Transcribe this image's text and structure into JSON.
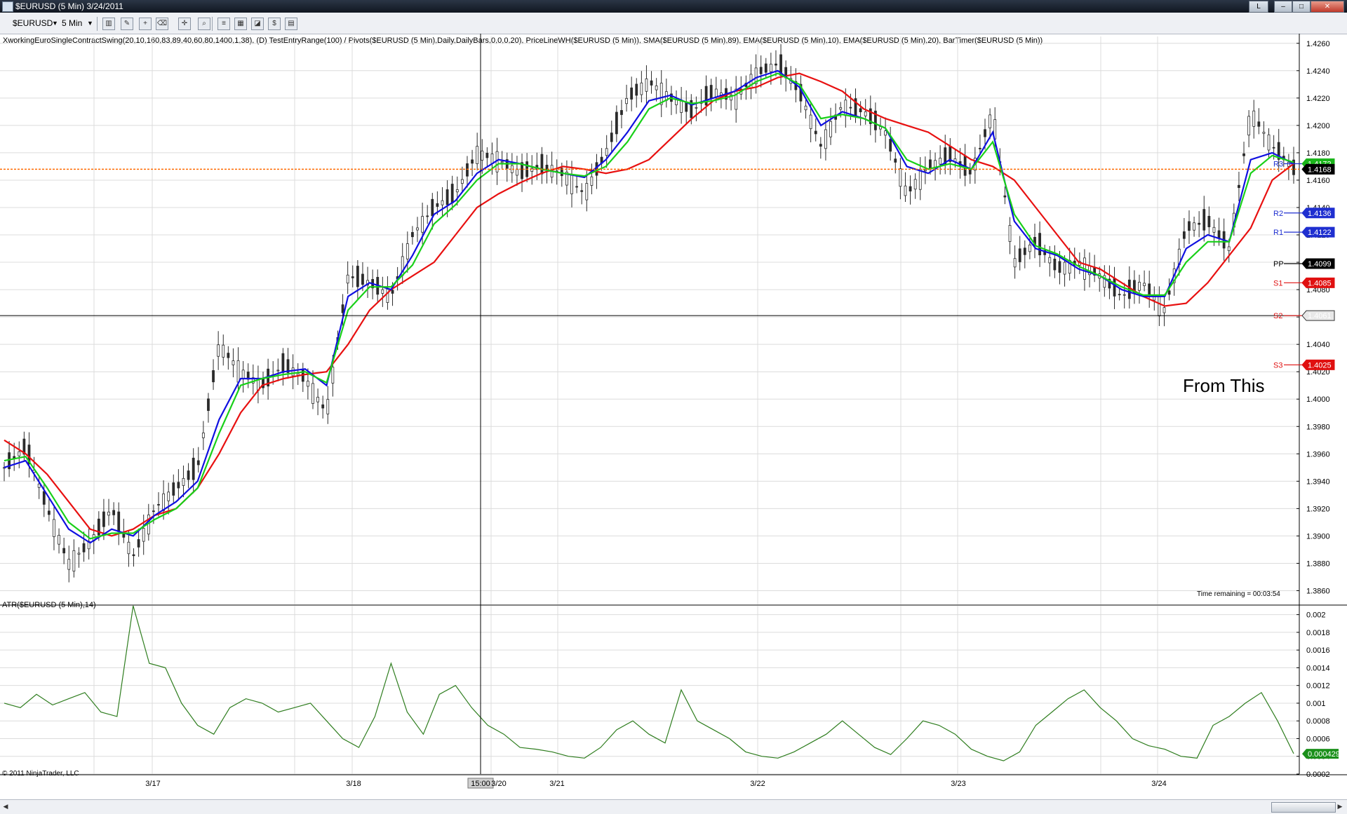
{
  "window": {
    "title": "$EURUSD (5 Min)  3/24/2011",
    "buttons": [
      "L",
      "–",
      "□",
      "✕"
    ]
  },
  "toolbar": {
    "instrument": "$EURUSD",
    "interval": "5 Min",
    "icons": [
      "bars-style-icon",
      "draw-icon",
      "zoom-icon",
      "eraser-icon",
      "crosshair-icon",
      "search-icon",
      "properties-icon",
      "strategies-icon",
      "indicators-icon",
      "data-box-icon",
      "dollar-icon",
      "window-icon"
    ]
  },
  "indicator_text": "XworkingEuroSingleContractSwing(20,10,160,83,89,40,60,80,1400,1,38), (D) TestEntryRange(100) / Pivots($EURUSD (5 Min),Daily,DailyBars,0,0,0,20), PriceLineWH($EURUSD (5 Min)), SMA($EURUSD (5 Min),89), EMA($EURUSD (5 Min),10), EMA($EURUSD (5 Min),20), BarTimer($EURUSD (5 Min))",
  "atr_label": "ATR($EURUSD (5 Min),14)",
  "time_remaining": "Time remaining = 00:03:54",
  "copyright": "© 2011 NinjaTrader, LLC",
  "annotation": "From This",
  "crosshair_time": "15:00",
  "colors": {
    "sma": "#e81010",
    "ema_fast": "#1010e0",
    "ema_slow": "#18d018",
    "candle": "#2b2b2b",
    "atr": "#2e7d1e",
    "price_line": "#ff6a00",
    "pivot_r": "#1f2fd0",
    "pivot_s": "#e01010",
    "pivot_pp": "#000000"
  },
  "chart_data": [
    {
      "type": "line",
      "title": "$EURUSD (5 Min)",
      "x": [
        "3/17",
        "3/18",
        "3/20",
        "3/21",
        "3/22",
        "3/23",
        "3/24"
      ],
      "ylim": [
        1.385,
        1.4265
      ],
      "yticks": [
        "1.4260",
        "1.4240",
        "1.4220",
        "1.4200",
        "1.4180",
        "1.4160",
        "1.4140",
        "1.4120",
        "1.4100",
        "1.4080",
        "1.4060",
        "1.4040",
        "1.4020",
        "1.4000",
        "1.3980",
        "1.3960",
        "1.3940",
        "1.3920",
        "1.3900",
        "1.3880",
        "1.3860"
      ],
      "grid": true,
      "series": [
        {
          "name": "SMA($EURUSD (5 Min),89)",
          "values": [
            1.397,
            1.396,
            1.3945,
            1.3925,
            1.3905,
            1.39,
            1.3905,
            1.3915,
            1.392,
            1.3935,
            1.396,
            1.399,
            1.401,
            1.4015,
            1.4018,
            1.402,
            1.404,
            1.4065,
            1.408,
            1.409,
            1.41,
            1.412,
            1.414,
            1.415,
            1.4158,
            1.4165,
            1.417,
            1.4168,
            1.4165,
            1.4168,
            1.4175,
            1.419,
            1.4205,
            1.4218,
            1.4225,
            1.4228,
            1.4235,
            1.4238,
            1.4232,
            1.4225,
            1.4212,
            1.4205,
            1.42,
            1.4195,
            1.4185,
            1.4175,
            1.417,
            1.416,
            1.414,
            1.412,
            1.41,
            1.4095,
            1.4085,
            1.4075,
            1.4068,
            1.407,
            1.4085,
            1.4105,
            1.4125,
            1.416,
            1.4172
          ]
        },
        {
          "name": "EMA($EURUSD (5 Min),10)",
          "values": [
            1.395,
            1.3955,
            1.393,
            1.3905,
            1.3895,
            1.3905,
            1.39,
            1.3915,
            1.3925,
            1.394,
            1.3985,
            1.4015,
            1.4015,
            1.402,
            1.4022,
            1.401,
            1.4075,
            1.4085,
            1.408,
            1.4105,
            1.4135,
            1.4145,
            1.4165,
            1.4175,
            1.4172,
            1.4168,
            1.4165,
            1.4162,
            1.4175,
            1.4195,
            1.4218,
            1.4222,
            1.4215,
            1.422,
            1.4225,
            1.4235,
            1.424,
            1.4228,
            1.42,
            1.421,
            1.4205,
            1.4198,
            1.417,
            1.4165,
            1.4175,
            1.4168,
            1.4195,
            1.413,
            1.411,
            1.4105,
            1.4095,
            1.409,
            1.408,
            1.4075,
            1.4075,
            1.411,
            1.412,
            1.4115,
            1.4175,
            1.418,
            1.4172
          ]
        },
        {
          "name": "EMA($EURUSD (5 Min),20)",
          "values": [
            1.3955,
            1.3958,
            1.3935,
            1.391,
            1.3898,
            1.3902,
            1.3902,
            1.3912,
            1.392,
            1.3935,
            1.3975,
            1.401,
            1.4015,
            1.4018,
            1.402,
            1.4012,
            1.4065,
            1.4082,
            1.4082,
            1.4098,
            1.4128,
            1.4142,
            1.416,
            1.4172,
            1.4172,
            1.4168,
            1.4165,
            1.4163,
            1.417,
            1.4188,
            1.4212,
            1.422,
            1.4216,
            1.4218,
            1.4222,
            1.4232,
            1.4238,
            1.423,
            1.4205,
            1.4208,
            1.4205,
            1.4198,
            1.4175,
            1.4168,
            1.4172,
            1.4168,
            1.4188,
            1.4135,
            1.4112,
            1.4106,
            1.4097,
            1.409,
            1.4082,
            1.4076,
            1.4076,
            1.41,
            1.4115,
            1.4115,
            1.4165,
            1.4178,
            1.4173
          ]
        },
        {
          "name": "Close",
          "values": [
            1.395,
            1.3965,
            1.392,
            1.388,
            1.3895,
            1.392,
            1.3885,
            1.392,
            1.3935,
            1.395,
            1.404,
            1.402,
            1.401,
            1.4025,
            1.4015,
            1.399,
            1.409,
            1.4085,
            1.4075,
            1.412,
            1.414,
            1.415,
            1.418,
            1.4175,
            1.4165,
            1.417,
            1.4165,
            1.415,
            1.418,
            1.422,
            1.4232,
            1.422,
            1.421,
            1.4225,
            1.422,
            1.4238,
            1.4245,
            1.4225,
            1.4185,
            1.4215,
            1.421,
            1.4195,
            1.415,
            1.417,
            1.4178,
            1.4165,
            1.421,
            1.41,
            1.4115,
            1.4095,
            1.41,
            1.409,
            1.4075,
            1.4085,
            1.4065,
            1.4125,
            1.413,
            1.411,
            1.421,
            1.4185,
            1.4168
          ]
        }
      ],
      "price_line": 1.4168,
      "crosshair_price": 1.4061,
      "pivots": [
        {
          "label": "R3",
          "value": 1.4172
        },
        {
          "label": "R2",
          "value": 1.4136
        },
        {
          "label": "R1",
          "value": 1.4122
        },
        {
          "label": "PP",
          "value": 1.4099
        },
        {
          "label": "S1",
          "value": 1.4085
        },
        {
          "label": "S2",
          "value": 1.4061
        },
        {
          "label": "S3",
          "value": 1.4025
        }
      ],
      "badges": [
        {
          "text": "1.4172",
          "value": 1.4172,
          "color": "#1bb51b"
        },
        {
          "text": "1.4168",
          "value": 1.4168,
          "color": "#000000"
        },
        {
          "text": "1.4136",
          "value": 1.4136,
          "color": "#1f2fd0"
        },
        {
          "text": "1.4122",
          "value": 1.4122,
          "color": "#1f2fd0"
        },
        {
          "text": "1.4099",
          "value": 1.4099,
          "color": "#000000"
        },
        {
          "text": "1.4085",
          "value": 1.4085,
          "color": "#e01010"
        },
        {
          "text": "1.4061",
          "value": 1.4061,
          "color": "#e8e8e8"
        },
        {
          "text": "1.4025",
          "value": 1.4025,
          "color": "#e01010"
        }
      ]
    },
    {
      "type": "line",
      "title": "ATR($EURUSD (5 Min),14)",
      "ylim": [
        0.0002,
        0.0021
      ],
      "yticks": [
        "0.002",
        "0.0018",
        "0.0016",
        "0.0014",
        "0.0012",
        "0.001",
        "0.0008",
        "0.0006",
        "0.0004",
        "0.0002"
      ],
      "series": [
        {
          "name": "ATR($EURUSD (5 Min),14)",
          "values": [
            0.001,
            0.00095,
            0.0011,
            0.00098,
            0.00105,
            0.00112,
            0.0009,
            0.00085,
            0.0021,
            0.00145,
            0.0014,
            0.001,
            0.00075,
            0.00065,
            0.00095,
            0.00105,
            0.001,
            0.0009,
            0.00095,
            0.001,
            0.0008,
            0.0006,
            0.0005,
            0.00085,
            0.00145,
            0.0009,
            0.00065,
            0.0011,
            0.0012,
            0.00095,
            0.00075,
            0.00065,
            0.0005,
            0.00048,
            0.00045,
            0.0004,
            0.00038,
            0.0005,
            0.0007,
            0.0008,
            0.00065,
            0.00055,
            0.00115,
            0.0008,
            0.0007,
            0.0006,
            0.00045,
            0.0004,
            0.00038,
            0.00045,
            0.00055,
            0.00065,
            0.0008,
            0.00065,
            0.0005,
            0.00042,
            0.0006,
            0.0008,
            0.00075,
            0.00065,
            0.00048,
            0.0004,
            0.00035,
            0.00045,
            0.00075,
            0.0009,
            0.00105,
            0.00115,
            0.00095,
            0.0008,
            0.0006,
            0.00052,
            0.00048,
            0.0004,
            0.00038,
            0.00075,
            0.00085,
            0.001,
            0.00112,
            0.0008,
            0.00043
          ]
        }
      ],
      "last_value": "0.000429"
    }
  ]
}
